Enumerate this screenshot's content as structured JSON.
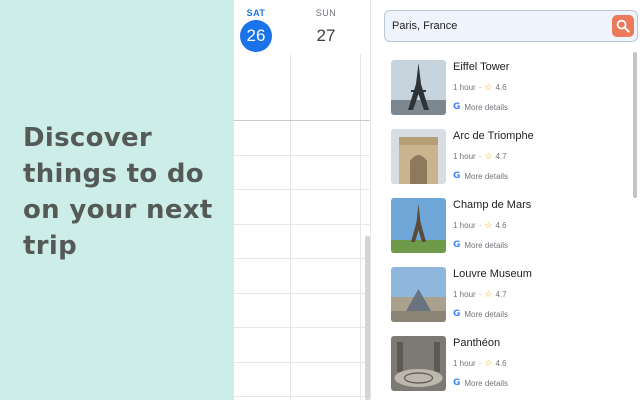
{
  "promo": {
    "headline": "Discover things to do on your next trip"
  },
  "calendar": {
    "days": [
      {
        "dow": "SAT",
        "date": "26",
        "selected": true
      },
      {
        "dow": "SUN",
        "date": "27",
        "selected": false
      }
    ]
  },
  "search": {
    "value": "Paris, France",
    "button_icon": "search-icon"
  },
  "results": [
    {
      "name": "Eiffel Tower",
      "duration": "1 hour",
      "rating": "4.6",
      "details": "More details"
    },
    {
      "name": "Arc de Triomphe",
      "duration": "1 hour",
      "rating": "4.7",
      "details": "More details"
    },
    {
      "name": "Champ de Mars",
      "duration": "1 hour",
      "rating": "4.6",
      "details": "More details"
    },
    {
      "name": "Louvre Museum",
      "duration": "1 hour",
      "rating": "4.7",
      "details": "More details"
    },
    {
      "name": "Panthéon",
      "duration": "1 hour",
      "rating": "4.6",
      "details": "More details"
    }
  ],
  "colors": {
    "accent": "#1a73e8",
    "search_button": "#ea7a5a",
    "promo_bg": "#cdeee8",
    "star": "#f4b400"
  }
}
